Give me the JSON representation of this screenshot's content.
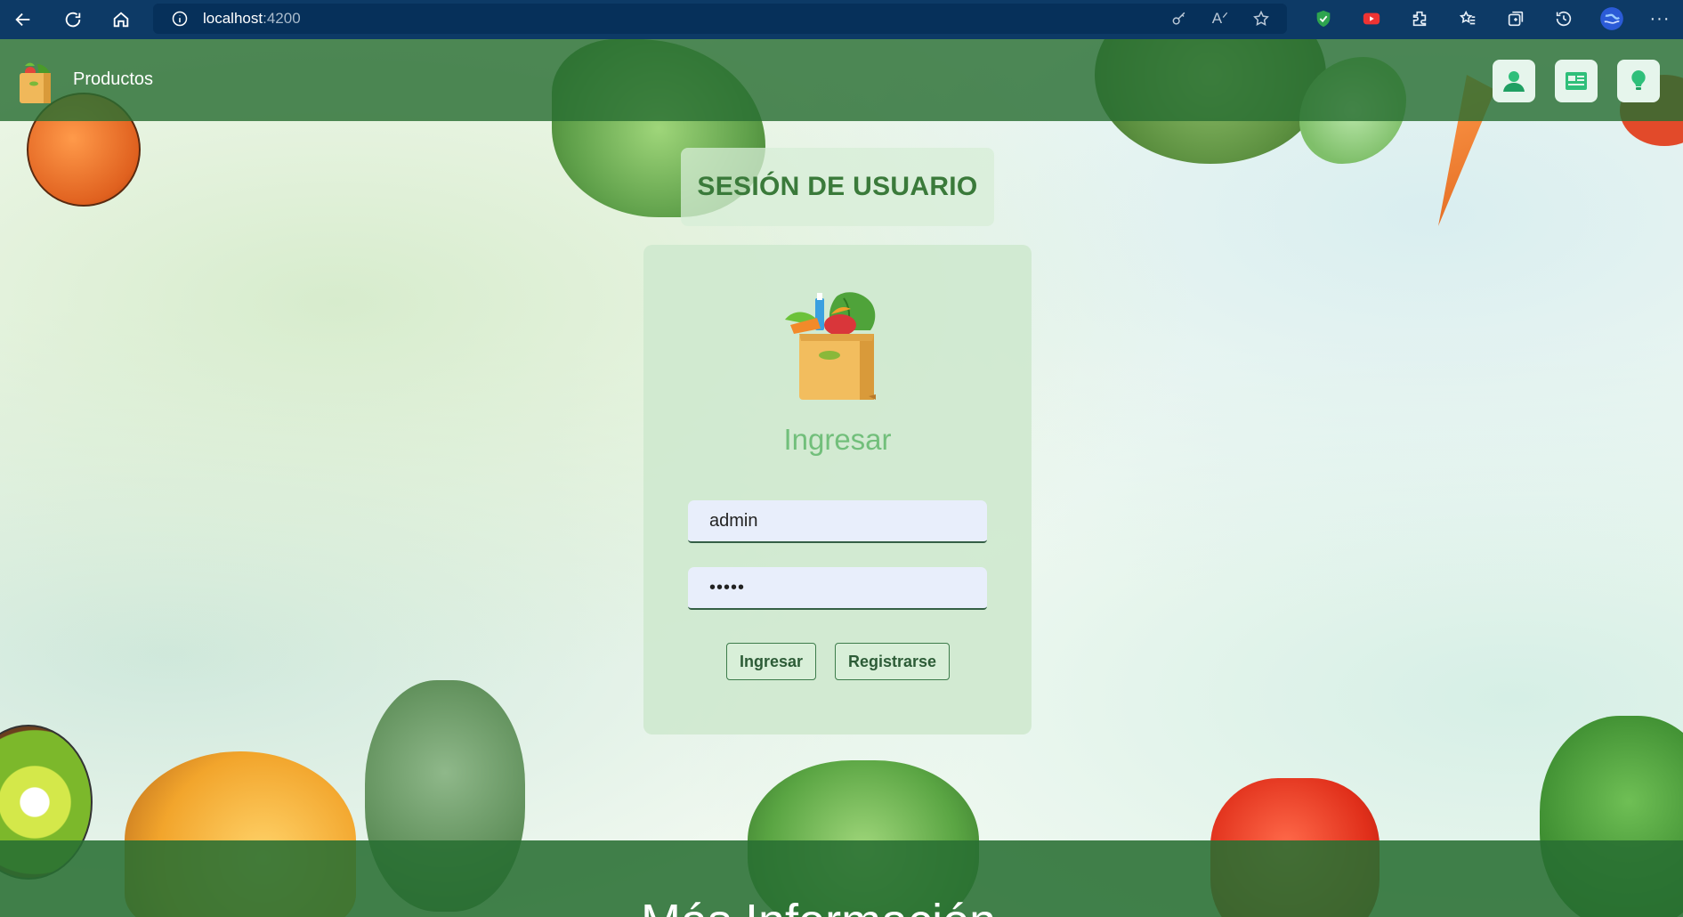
{
  "browser": {
    "url_host": "localhost",
    "url_port": ":4200"
  },
  "header": {
    "brand": "Productos",
    "actions": [
      {
        "icon": "user-icon"
      },
      {
        "icon": "catalog-icon"
      },
      {
        "icon": "lightbulb-icon"
      }
    ]
  },
  "login": {
    "section_title": "SESIÓN DE USUARIO",
    "heading": "Ingresar",
    "username_value": "admin",
    "password_value": "•••••",
    "login_button": "Ingresar",
    "register_button": "Registrarse"
  },
  "footer": {
    "title": "Más Información"
  },
  "colors": {
    "header_bg": "#2f6e3a",
    "card_bg": "#cee8ce",
    "heading_green": "#72bf7b",
    "title_green": "#3a7a3a"
  }
}
